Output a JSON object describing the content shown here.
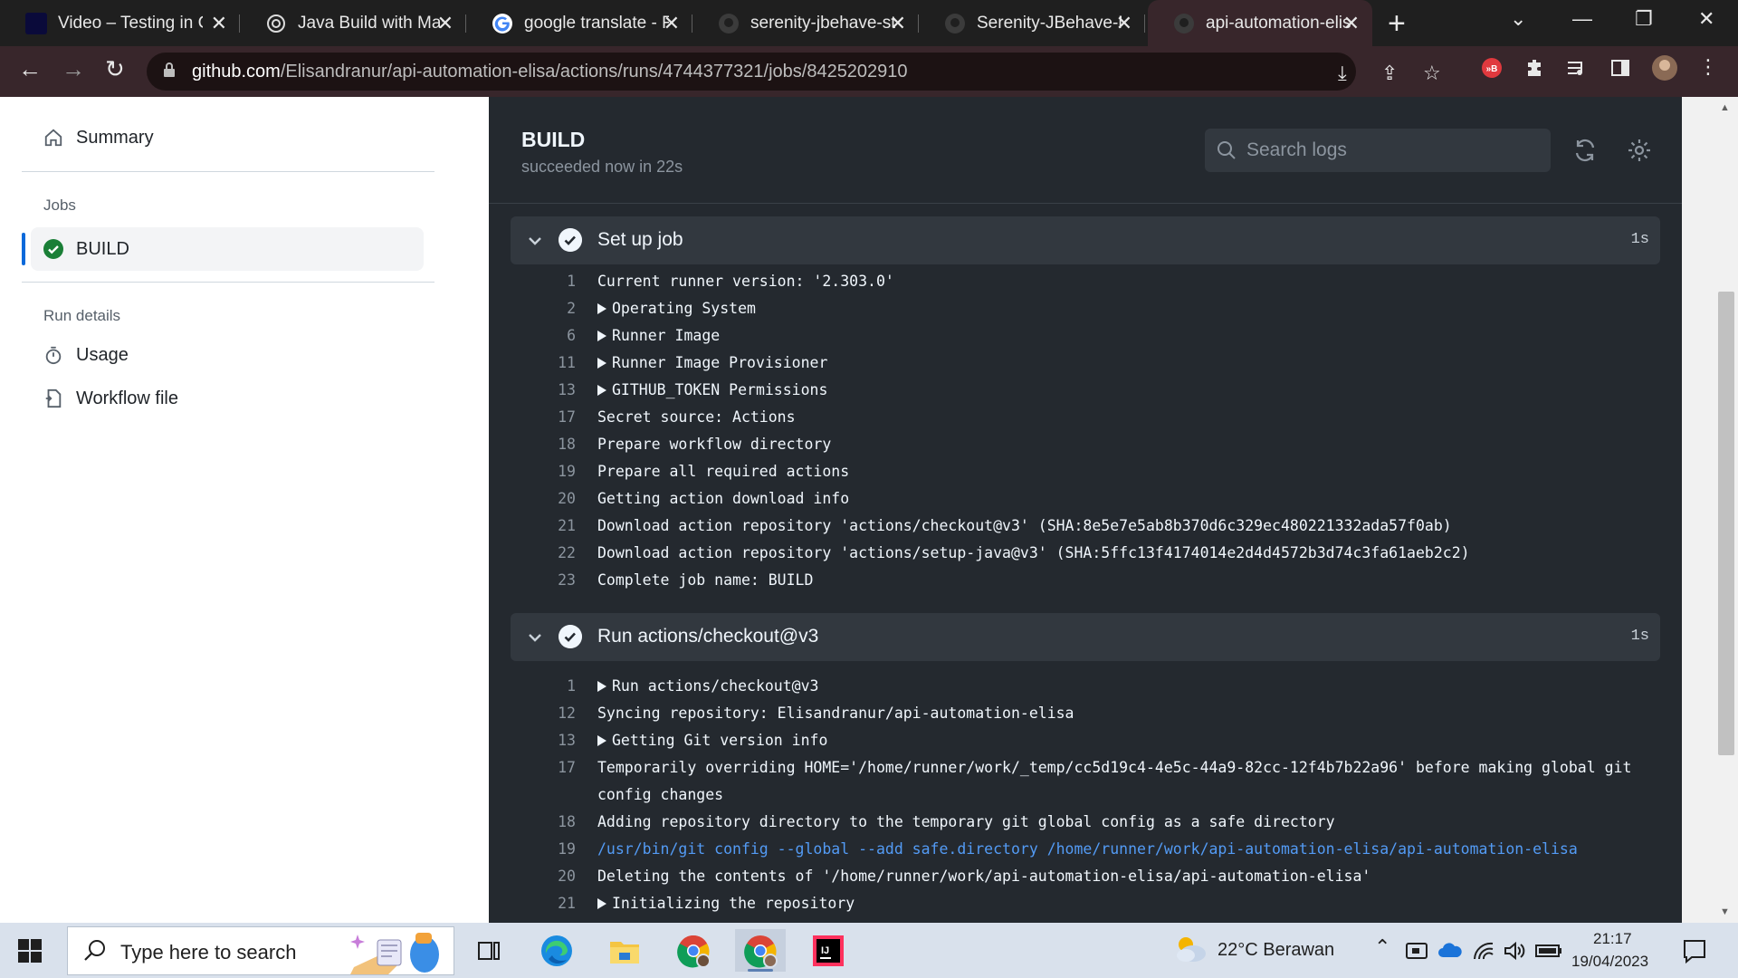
{
  "browser": {
    "tabs": [
      {
        "title": "Video – Testing in C",
        "favicon_color": "#0a0a3a",
        "active": false
      },
      {
        "title": "Java Build with Mav",
        "favicon_color": "#e0e0e0",
        "active": false
      },
      {
        "title": "google translate - F",
        "favicon_color": "#ffffff",
        "active": false
      },
      {
        "title": "serenity-jbehave-st",
        "favicon_color": "#3b3b3b",
        "active": false
      },
      {
        "title": "Serenity-JBehave-M",
        "favicon_color": "#3b3b3b",
        "active": false
      },
      {
        "title": "api-automation-elis",
        "favicon_color": "#3b3b3b",
        "active": true
      }
    ],
    "url_host": "github.com",
    "url_path": "/Elisandranur/api-automation-elisa/actions/runs/4744377321/jobs/8425202910"
  },
  "sidebar": {
    "summary_label": "Summary",
    "jobs_heading": "Jobs",
    "job_name": "BUILD",
    "run_details_heading": "Run details",
    "usage_label": "Usage",
    "workflow_file_label": "Workflow file"
  },
  "main": {
    "title": "BUILD",
    "subtitle": "succeeded now in 22s",
    "search_placeholder": "Search logs"
  },
  "steps": [
    {
      "name": "Set up job",
      "duration": "1s",
      "lines": [
        {
          "num": "1",
          "text": "Current runner version: '2.303.0'",
          "collapsible": false
        },
        {
          "num": "2",
          "text": "Operating System",
          "collapsible": true
        },
        {
          "num": "6",
          "text": "Runner Image",
          "collapsible": true
        },
        {
          "num": "11",
          "text": "Runner Image Provisioner",
          "collapsible": true
        },
        {
          "num": "13",
          "text": "GITHUB_TOKEN Permissions",
          "collapsible": true
        },
        {
          "num": "17",
          "text": "Secret source: Actions",
          "collapsible": false
        },
        {
          "num": "18",
          "text": "Prepare workflow directory",
          "collapsible": false
        },
        {
          "num": "19",
          "text": "Prepare all required actions",
          "collapsible": false
        },
        {
          "num": "20",
          "text": "Getting action download info",
          "collapsible": false
        },
        {
          "num": "21",
          "text": "Download action repository 'actions/checkout@v3' (SHA:8e5e7e5ab8b370d6c329ec480221332ada57f0ab)",
          "collapsible": false
        },
        {
          "num": "22",
          "text": "Download action repository 'actions/setup-java@v3' (SHA:5ffc13f4174014e2d4d4572b3d74c3fa61aeb2c2)",
          "collapsible": false
        },
        {
          "num": "23",
          "text": "Complete job name: BUILD",
          "collapsible": false
        }
      ]
    },
    {
      "name": "Run actions/checkout@v3",
      "duration": "1s",
      "lines": [
        {
          "num": "1",
          "text": "Run actions/checkout@v3",
          "collapsible": true
        },
        {
          "num": "12",
          "text": "Syncing repository: Elisandranur/api-automation-elisa",
          "collapsible": false
        },
        {
          "num": "13",
          "text": "Getting Git version info",
          "collapsible": true
        },
        {
          "num": "17",
          "text": "Temporarily overriding HOME='/home/runner/work/_temp/cc5d19c4-4e5c-44a9-82cc-12f4b7b22a96' before making global git config changes",
          "collapsible": false,
          "wrap": true
        },
        {
          "num": "18",
          "text": "Adding repository directory to the temporary git global config as a safe directory",
          "collapsible": false
        },
        {
          "num": "19",
          "text": "/usr/bin/git config --global --add safe.directory /home/runner/work/api-automation-elisa/api-automation-elisa",
          "collapsible": false,
          "command": true
        },
        {
          "num": "20",
          "text": "Deleting the contents of '/home/runner/work/api-automation-elisa/api-automation-elisa'",
          "collapsible": false
        },
        {
          "num": "21",
          "text": "Initializing the repository",
          "collapsible": true
        }
      ]
    }
  ],
  "taskbar": {
    "search_placeholder": "Type here to search",
    "weather": "22°C  Berawan",
    "time": "21:17",
    "date": "19/04/2023"
  },
  "colors": {
    "log_bg": "#24292f",
    "step_bg": "#32383f",
    "accent_blue": "#0969da",
    "success_green": "#1a7f37",
    "command_blue": "#539bf5"
  }
}
